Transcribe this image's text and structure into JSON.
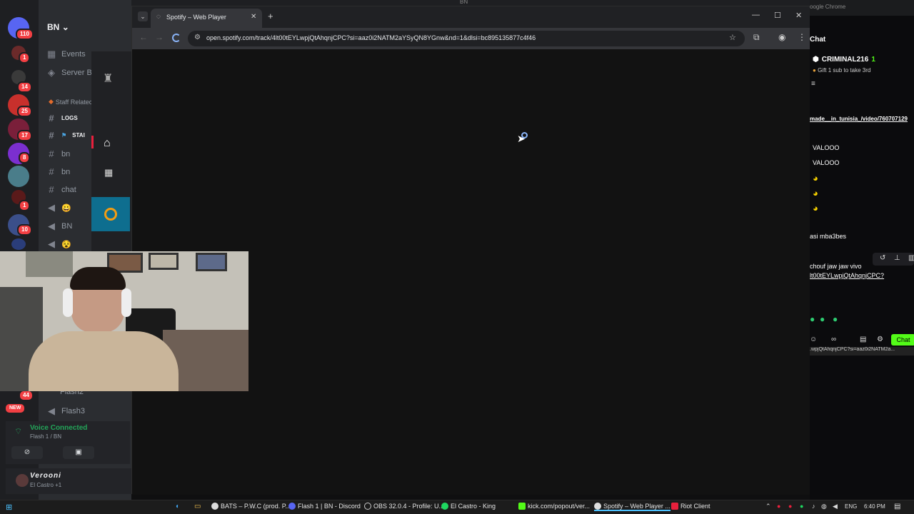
{
  "discord": {
    "server_name": "BN",
    "server_badges": [
      "110",
      "1",
      "14",
      "25",
      "17",
      "8",
      "1",
      "10",
      "44"
    ],
    "new_badge": "NEW",
    "channels": {
      "events": "Events",
      "server_boost": "Server Bo",
      "category": "Staff Relatec",
      "logs": "LOGS",
      "star": "STAI",
      "bn1": "bn",
      "bn2": "bn",
      "chat": "chat",
      "voice_emoji1": "😀",
      "voice_bn": "BN",
      "voice_emoji2": "😵",
      "flash2": "Flash2",
      "flash3": "Flash3"
    },
    "voice": {
      "status": "Voice Connected",
      "location": "Flash 1 / BN"
    },
    "user": {
      "name": "Verooni",
      "activity": "El Castro +1"
    }
  },
  "chrome": {
    "tab_title": "Spotify – Web Player",
    "url": "open.spotify.com/track/4lt00tEYLwpjQtAhqnjCPC?si=aaz0i2NATM2aYSyQN8YGnw&nd=1&dlsi=bc895135877c4f46",
    "background_window_title": "oogle Chrome",
    "background_window_tab": "BN"
  },
  "chat": {
    "header": "Chat",
    "user": "CRIMINAL216",
    "user_count": "1",
    "gift_text": "Gift 1 sub to take 3rd",
    "link": "made__in_tunisia_/video/760707129",
    "messages": [
      "VALOOO",
      "VALOOO",
      "asi mba3bes",
      "chouf jaw jaw vivo"
    ],
    "msg_link": "lt00tEYLwpjQtAhqnjCPC?",
    "send_button": "Chat",
    "hover_url": ".wpjQtAhqnjCPC?si=aaz0i2NATM2a..."
  },
  "taskbar": {
    "items": [
      "BATS – P.W.C (prod. P...",
      "Flash 1 | BN - Discord",
      "OBS 32.0.4 - Profile: U...",
      "El Castro - King",
      "kick.com/popout/ver...",
      "Spotify – Web Player ...",
      "Riot Client"
    ],
    "lang": "ENG",
    "time": "6:40 PM"
  },
  "colors": {
    "discord_green": "#23a559",
    "spotify_green": "#1ed760",
    "kick_green": "#53fc18",
    "badge_red": "#f23f43"
  }
}
